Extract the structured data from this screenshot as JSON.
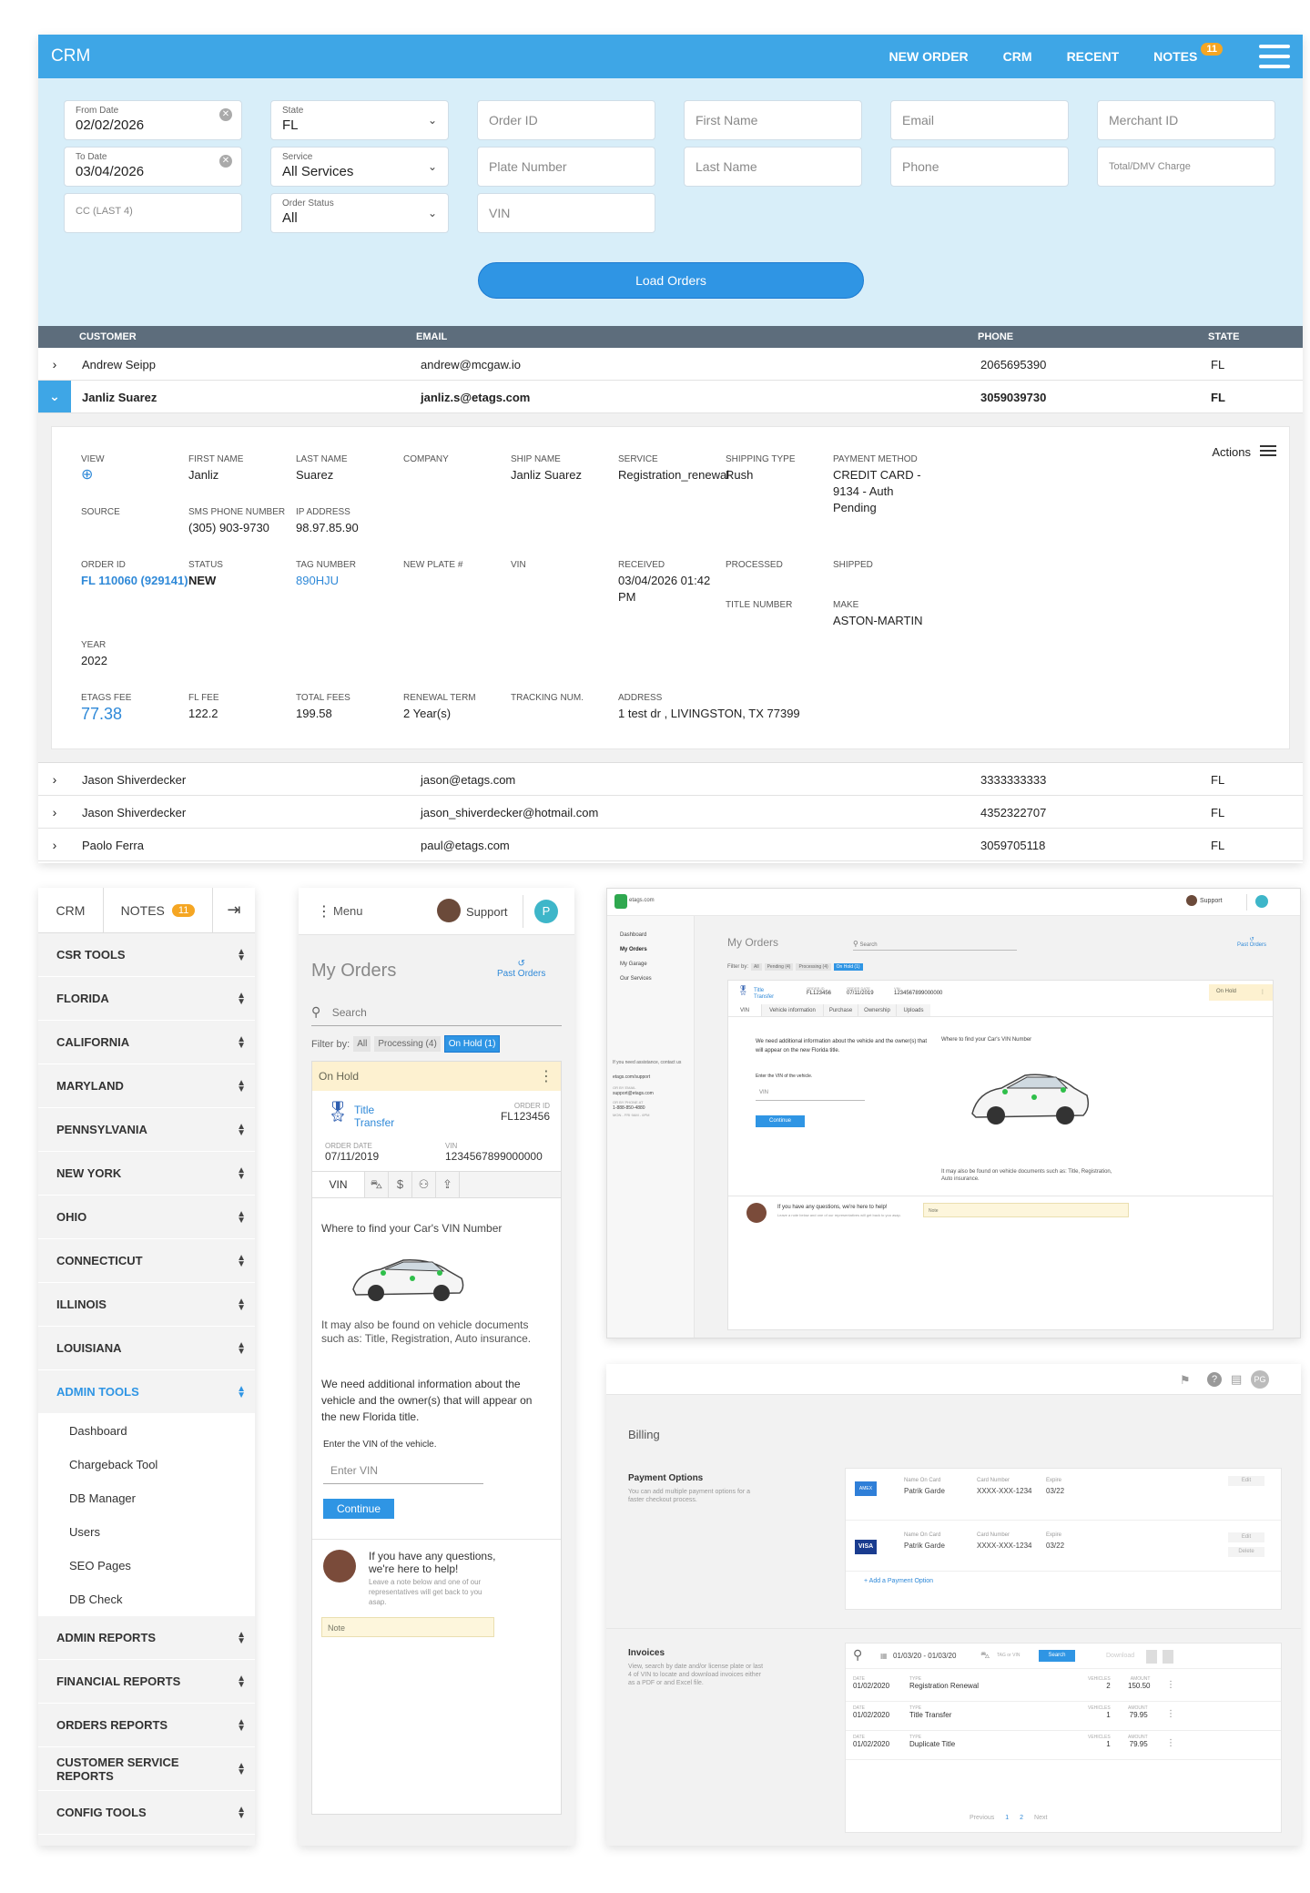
{
  "topbar": {
    "brand": "CRM",
    "nav": [
      "NEW ORDER",
      "CRM",
      "RECENT",
      "NOTES"
    ],
    "notes_badge": "11"
  },
  "filters": {
    "from_date": {
      "label": "From Date",
      "value": "02/02/2026"
    },
    "to_date": {
      "label": "To Date",
      "value": "03/04/2026"
    },
    "cc": "CC (LAST 4)",
    "state": {
      "label": "State",
      "value": "FL"
    },
    "service": {
      "label": "Service",
      "value": "All Services"
    },
    "order_status": {
      "label": "Order Status",
      "value": "All"
    },
    "order_id": "Order ID",
    "plate": "Plate Number",
    "vin": "VIN",
    "first_name": "First Name",
    "last_name": "Last Name",
    "email": "Email",
    "phone": "Phone",
    "merchant": "Merchant ID",
    "total": "Total/DMV Charge",
    "load": "Load Orders"
  },
  "table": {
    "headers": [
      "CUSTOMER",
      "EMAIL",
      "PHONE",
      "STATE"
    ],
    "rows_top": [
      {
        "name": "Andrew Seipp",
        "email": "andrew@mcgaw.io",
        "phone": "2065695390",
        "state": "FL"
      },
      {
        "name": "Janliz Suarez",
        "email": "janliz.s@etags.com",
        "phone": "3059039730",
        "state": "FL"
      }
    ],
    "rows_bottom": [
      {
        "name": "Jason Shiverdecker",
        "email": "jason@etags.com",
        "phone": "3333333333",
        "state": "FL"
      },
      {
        "name": "Jason Shiverdecker",
        "email": "jason_shiverdecker@hotmail.com",
        "phone": "4352322707",
        "state": "FL"
      },
      {
        "name": "Paolo Ferra",
        "email": "paul@etags.com",
        "phone": "3059705118",
        "state": "FL"
      }
    ]
  },
  "detail": {
    "actions": "Actions",
    "view": "VIEW",
    "first_name_k": "FIRST NAME",
    "first_name": "Janliz",
    "last_name_k": "LAST NAME",
    "last_name": "Suarez",
    "company_k": "COMPANY",
    "ship_name_k": "SHIP NAME",
    "ship_name": "Janliz Suarez",
    "service_k": "SERVICE",
    "service": "Registration_renewal",
    "shipping_k": "SHIPPING TYPE",
    "shipping": "Rush",
    "payment_k": "PAYMENT METHOD",
    "payment": "CREDIT CARD - 9134 - Auth Pending",
    "source_k": "SOURCE",
    "sms_k": "SMS PHONE NUMBER",
    "sms": "(305) 903-9730",
    "ip_k": "IP ADDRESS",
    "ip": "98.97.85.90",
    "order_id_k": "ORDER ID",
    "order_id": "FL 110060 (929141)",
    "status_k": "STATUS",
    "status": "NEW",
    "tag_k": "TAG NUMBER",
    "tag": "890HJU",
    "new_plate_k": "NEW PLATE #",
    "vin_k": "VIN",
    "received_k": "RECEIVED",
    "received": "03/04/2026 01:42 PM",
    "processed_k": "PROCESSED",
    "shipped_k": "SHIPPED",
    "title_num_k": "TITLE NUMBER",
    "make_k": "MAKE",
    "make": "ASTON-MARTIN",
    "year_k": "YEAR",
    "year": "2022",
    "etags_fee_k": "ETAGS FEE",
    "etags_fee": "77.38",
    "fl_fee_k": "FL FEE",
    "fl_fee": "122.2",
    "total_k": "TOTAL FEES",
    "total": "199.58",
    "term_k": "RENEWAL TERM",
    "term": "2 Year(s)",
    "tracking_k": "TRACKING NUM.",
    "address_k": "ADDRESS",
    "address": "1 test dr , LIVINGSTON, TX 77399"
  },
  "sidebar": {
    "tabs": [
      "CRM",
      "NOTES"
    ],
    "notes_badge": "11",
    "items_top": [
      "CSR TOOLS",
      "FLORIDA",
      "CALIFORNIA",
      "MARYLAND",
      "PENNSYLVANIA",
      "NEW YORK",
      "OHIO",
      "CONNECTICUT",
      "ILLINOIS",
      "LOUISIANA"
    ],
    "active": "ADMIN TOOLS",
    "subs": [
      "Dashboard",
      "Chargeback Tool",
      "DB Manager",
      "Users",
      "SEO Pages",
      "DB Check"
    ],
    "items_bottom": [
      "ADMIN REPORTS",
      "FINANCIAL REPORTS",
      "ORDERS REPORTS",
      "CUSTOMER SERVICE REPORTS",
      "CONFIG TOOLS"
    ]
  },
  "mobile": {
    "menu": "Menu",
    "support": "Support",
    "avatar": "P",
    "title": "My Orders",
    "past": "Past Orders",
    "search": "Search",
    "filter_by": "Filter by:",
    "filters": [
      "All",
      "Processing (4)",
      "On Hold (1)"
    ],
    "on_hold": "On Hold",
    "service": "Title Transfer",
    "order_id_k": "ORDER ID",
    "order_id": "FL123456",
    "order_date_k": "ORDER DATE",
    "order_date": "07/11/2019",
    "vin_k": "VIN",
    "vin": "1234567899000000",
    "tab_vin": "VIN",
    "where": "Where to find your Car's VIN Number",
    "found": "It may also be found on vehicle documents such as: Title, Registration, Auto insurance.",
    "need": "We need additional information about the vehicle and the owner(s) that will appear on the new Florida title.",
    "enter": "Enter the VIN of the vehicle.",
    "enter_ph": "Enter VIN",
    "continue": "Continue",
    "q": "If you have any questions, we're here to help!",
    "q_sub": "Leave a note below and one of our representatives will get back to you asap.",
    "note": "Note"
  },
  "desktop": {
    "logo": "etags.com",
    "support": "Support",
    "nav": [
      "Dashboard",
      "My Orders",
      "My Garage",
      "Our Services"
    ],
    "assist": "If you need assistance, contact us",
    "assist_link": "etags.com/support",
    "email_k": "OR BY EMAIL",
    "email": "support@etags.com",
    "phone_k": "OR BY PHONE AT",
    "phone": "1-888-850-4880",
    "hours": "MON - FRI 9AM - 6PM",
    "title": "My Orders",
    "search": "Search",
    "past": "Past Orders",
    "filter_by": "Filter by:",
    "filters": [
      "All",
      "Pending (4)",
      "Processing (4)",
      "On Hold (1)"
    ],
    "service": "Title Transfer",
    "order_id_k": "ORDER ID",
    "order_id": "FL123456",
    "order_date_k": "ORDER DATE",
    "order_date": "07/11/2019",
    "vin_k": "VIN",
    "vin": "1234567899000000",
    "on_hold": "On Hold",
    "tabs": [
      "VIN",
      "Vehicle information",
      "Purchase",
      "Ownership",
      "Uploads"
    ],
    "need": "We need additional information about the vehicle and the owner(s) that will appear on the new Florida title.",
    "enter": "Enter the VIN of the vehicle.",
    "vin_ph": "VIN",
    "continue": "Continue",
    "where": "Where to find your Car's VIN Number",
    "found": "It may also be found on vehicle documents such as: Title, Registration, Auto insurance.",
    "q": "If you have any questions, we're here to help!",
    "q_sub": "Leave a note below and one of our representatives will get back to you asap.",
    "note": "Note"
  },
  "billing": {
    "avatar": "PG",
    "title": "Billing",
    "payment_title": "Payment Options",
    "payment_sub": "You can add multiple payment options for a faster checkout process.",
    "cards": [
      {
        "brand": "AMEX",
        "name_k": "Name On Card",
        "name": "Patrik Garde",
        "num_k": "Card Number",
        "num": "XXXX-XXX-1234",
        "exp_k": "Expire",
        "exp": "03/22",
        "actions": [
          "Edit"
        ]
      },
      {
        "brand": "VISA",
        "name_k": "Name On Card",
        "name": "Patrik Garde",
        "num_k": "Card Number",
        "num": "XXXX-XXX-1234",
        "exp_k": "Expire",
        "exp": "03/22",
        "actions": [
          "Edit",
          "Delete"
        ]
      }
    ],
    "add": "+ Add a Payment Option",
    "inv_title": "Invoices",
    "inv_sub": "View, search by date and/or license plate or last 4 of VIN to locate and download invoices either as a PDF or and Excel file.",
    "date_range": "01/03/20 - 01/03/20",
    "tag_ph": "TAG or VIN",
    "search": "Search",
    "download": "Download",
    "invoices": [
      {
        "date_k": "DATE",
        "date": "01/02/2020",
        "type_k": "TYPE",
        "type": "Registration Renewal",
        "veh_k": "VEHICLES",
        "veh": "2",
        "amt_k": "AMOUNT",
        "amt": "150.50"
      },
      {
        "date_k": "DATE",
        "date": "01/02/2020",
        "type_k": "TYPE",
        "type": "Title Transfer",
        "veh_k": "VEHICLES",
        "veh": "1",
        "amt_k": "AMOUNT",
        "amt": "79.95"
      },
      {
        "date_k": "DATE",
        "date": "01/02/2020",
        "type_k": "TYPE",
        "type": "Duplicate Title",
        "veh_k": "VEHICLES",
        "veh": "1",
        "amt_k": "AMOUNT",
        "amt": "79.95"
      }
    ],
    "pager": [
      "Previous",
      "1",
      "2",
      "Next"
    ]
  }
}
